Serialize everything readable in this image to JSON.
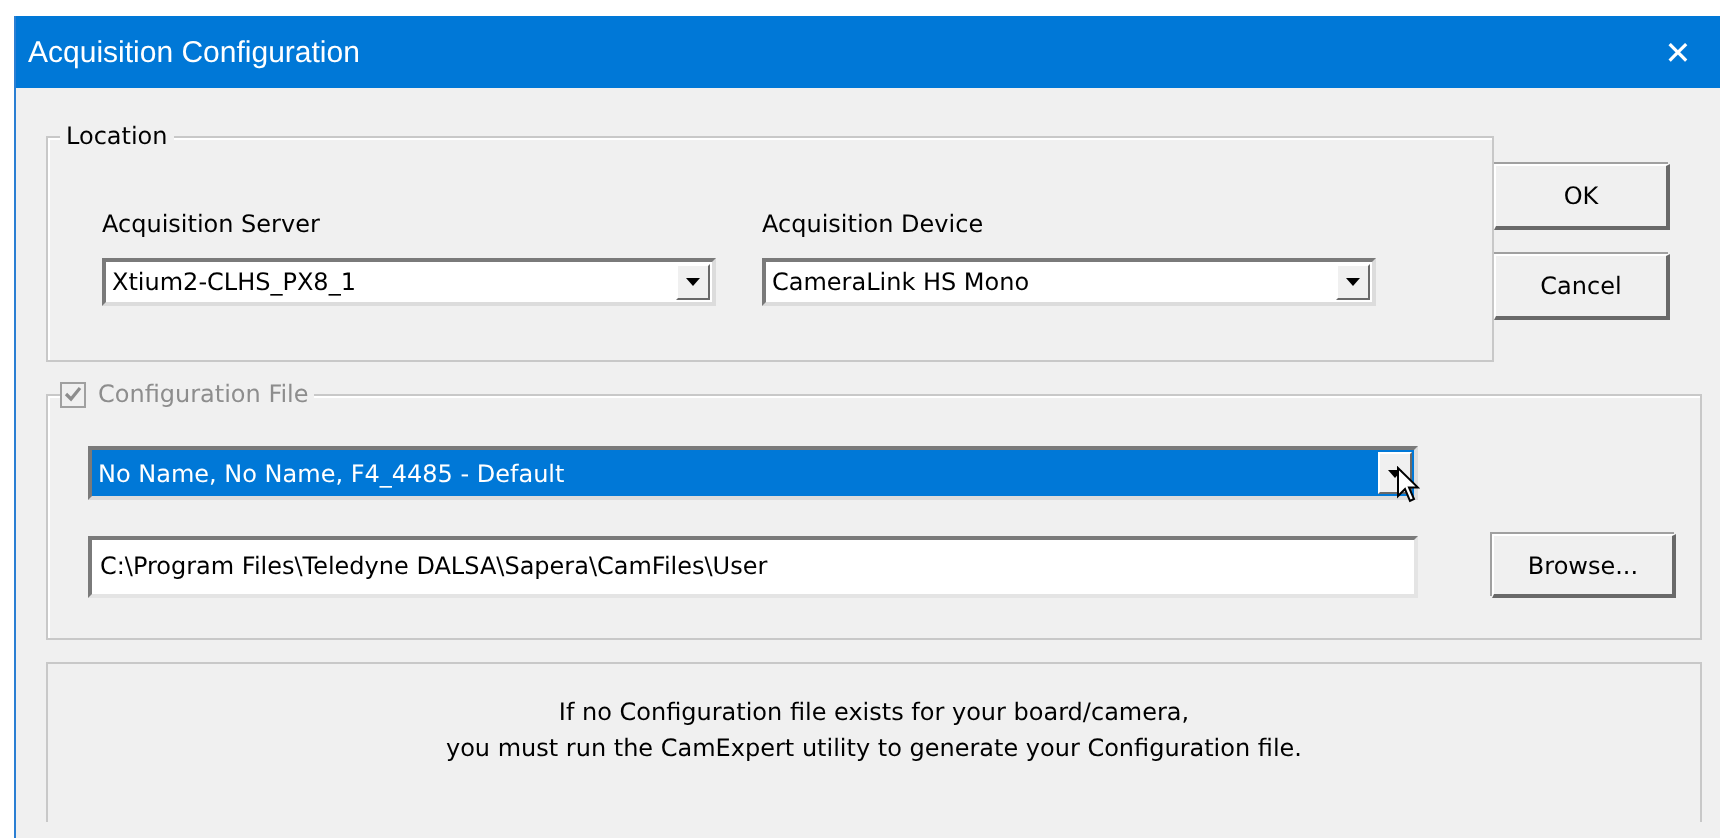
{
  "window": {
    "title": "Acquisition Configuration",
    "close": "✕"
  },
  "location": {
    "label": "Location",
    "fields": [
      {
        "label": "Acquisition Server",
        "value": "Xtium2-CLHS_PX8_1"
      },
      {
        "label": "Acquisition Device",
        "value": "CameraLink HS Mono"
      }
    ]
  },
  "buttons": [
    {
      "label": "OK"
    },
    {
      "label": "Cancel"
    }
  ],
  "config_file": {
    "label": "Configuration File",
    "checked": true,
    "disabled": true,
    "combo": {
      "value": "No Name, No Name, F4_4485 - Default",
      "highlighted": true
    },
    "path": {
      "value": "C:\\Program Files\\Teledyne DALSA\\Sapera\\CamFiles\\User"
    },
    "browse": "Browse..."
  },
  "info": [
    "If no Configuration file exists for your board/camera,",
    "you must run the CamExpert utility to generate your Configuration file."
  ]
}
